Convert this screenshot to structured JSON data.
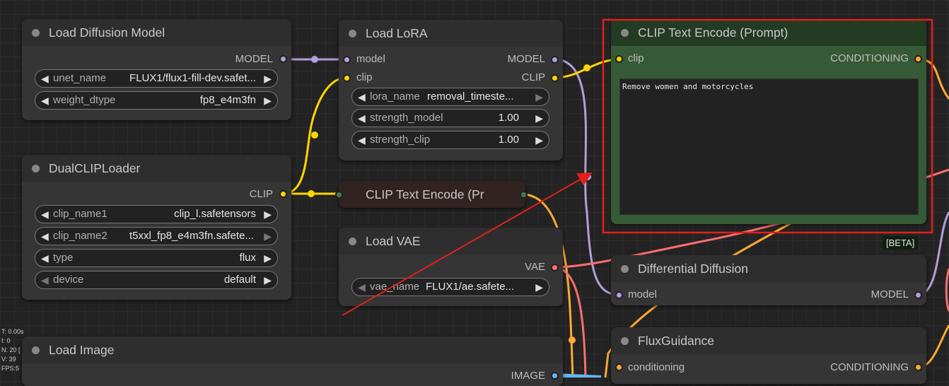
{
  "colors": {
    "model": "#b39ddb",
    "clip": "#ffd500",
    "conditioning": "#ffa931",
    "vae": "#ff6e6e",
    "image": "#64b5f6",
    "highlight": "#e0201b",
    "encode_green": "#355a35"
  },
  "nodes": {
    "load_diffusion_model": {
      "title": "Load Diffusion Model",
      "output_model": "MODEL",
      "unet_name_label": "unet_name",
      "unet_name_value": "FLUX1/flux1-fill-dev.safet...",
      "weight_dtype_label": "weight_dtype",
      "weight_dtype_value": "fp8_e4m3fn"
    },
    "dual_clip_loader": {
      "title": "DualCLIPLoader",
      "output_clip": "CLIP",
      "clip_name1_label": "clip_name1",
      "clip_name1_value": "clip_l.safetensors",
      "clip_name2_label": "clip_name2",
      "clip_name2_value": "t5xxl_fp8_e4m3fn.safete...",
      "type_label": "type",
      "type_value": "flux",
      "device_label": "device",
      "device_value": "default"
    },
    "load_lora": {
      "title": "Load LoRA",
      "input_model": "model",
      "input_clip": "clip",
      "output_model": "MODEL",
      "output_clip": "CLIP",
      "lora_name_label": "lora_name",
      "lora_name_value": "removal_timeste...",
      "strength_model_label": "strength_model",
      "strength_model_value": "1.00",
      "strength_clip_label": "strength_clip",
      "strength_clip_value": "1.00"
    },
    "clip_text_encode_collapsed": {
      "title": "CLIP Text Encode (Pr"
    },
    "load_vae": {
      "title": "Load VAE",
      "output_vae": "VAE",
      "vae_name_label": "vae_name",
      "vae_name_value": "FLUX1/ae.safete..."
    },
    "clip_text_encode_prompt": {
      "title": "CLIP Text Encode (Prompt)",
      "input_clip": "clip",
      "output_conditioning": "CONDITIONING",
      "text": "Remove women and motorcycles",
      "badge": "[BETA]"
    },
    "differential_diffusion": {
      "title": "Differential Diffusion",
      "input_model": "model",
      "output_model": "MODEL"
    },
    "load_image": {
      "title": "Load Image",
      "output_image": "IMAGE"
    },
    "flux_guidance": {
      "title": "FluxGuidance",
      "input_conditioning": "conditioning",
      "output_conditioning": "CONDITIONING"
    }
  },
  "stats": [
    "T: 0.00s",
    "I: 0",
    "N: 20 [",
    "V: 39",
    "FPS:5"
  ]
}
